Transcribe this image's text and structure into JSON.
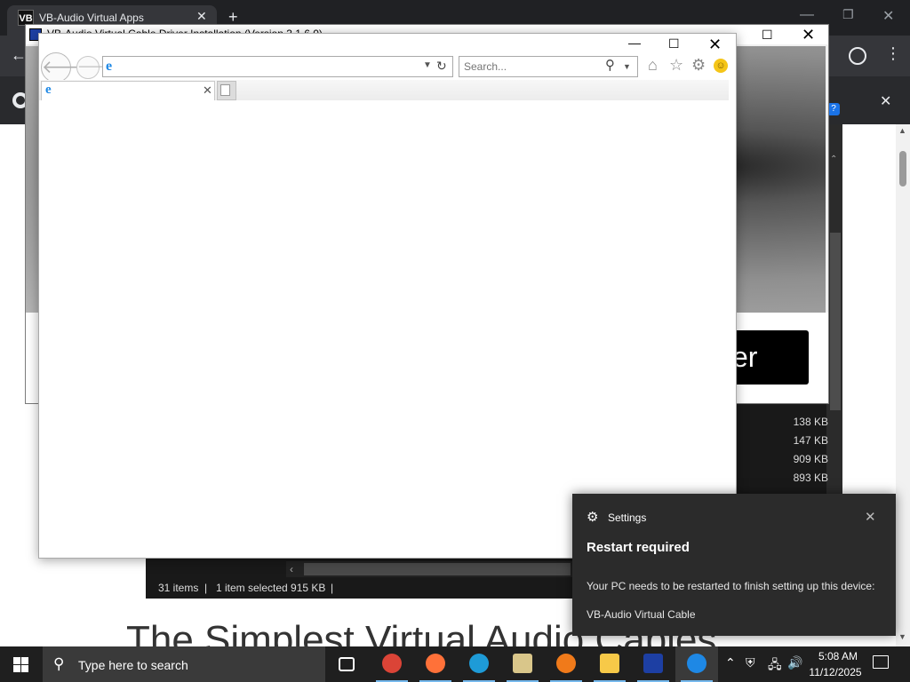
{
  "chrome": {
    "tab_title": "VB-Audio Virtual Apps",
    "favicon_text": "VB",
    "tab_close": "✕",
    "new_tab": "+",
    "minimize": "—",
    "maximize": "❐",
    "close": "✕",
    "back": "←",
    "menu": "⋮",
    "infobar_close": "✕",
    "infobar_help": "?",
    "page_heading": "The Simplest Virtual Audio Cables"
  },
  "explorer": {
    "file_sizes": [
      "138 KB",
      "147 KB",
      "909 KB",
      "893 KB"
    ],
    "status_items": "31 items",
    "status_selected": "1 item selected  915 KB"
  },
  "installer": {
    "title": "VB-Audio Virtual Cable Driver Installation (Version 3.1.6.0)",
    "maximize": "☐",
    "close": "✕",
    "button_label": "er"
  },
  "ie": {
    "minimize": "—",
    "maximize": "☐",
    "close": "✕",
    "back": "🡐",
    "forward": "🡒",
    "address_value": "",
    "search_placeholder": "Search...",
    "tab_title": "",
    "tab_close": "✕",
    "refresh": "↻",
    "dropdown": "▼",
    "search_icon": "⚲",
    "home": "⌂",
    "star": "☆",
    "gear": "⚙",
    "smiley": "☺",
    "ie_glyph": "e"
  },
  "toast": {
    "app_name": "Settings",
    "close": "✕",
    "gear": "⚙",
    "title": "Restart required",
    "body": "Your PC needs to be restarted to finish setting up this device:",
    "device": "VB-Audio Virtual Cable"
  },
  "taskbar": {
    "search_placeholder": "Type here to search",
    "search_icon": "⚲",
    "time": "5:08 AM",
    "date": "11/12/2025",
    "tray_chevron": "⌃",
    "tray_shield": "⛨",
    "tray_network": "🖧",
    "tray_volume": "🔊",
    "apps": [
      {
        "name": "task-view",
        "color": "#ffffff"
      },
      {
        "name": "chrome",
        "color": "#db4437"
      },
      {
        "name": "firefox",
        "color": "#ff7139"
      },
      {
        "name": "edge",
        "color": "#1e9bd7"
      },
      {
        "name": "setup-app",
        "color": "#d9c68a"
      },
      {
        "name": "fl-studio",
        "color": "#f07a1a"
      },
      {
        "name": "file-explorer",
        "color": "#f7c948"
      },
      {
        "name": "vb-audio-installer",
        "color": "#1d3fa3"
      },
      {
        "name": "internet-explorer",
        "color": "#1e88e5"
      }
    ]
  },
  "colors": {
    "chrome_dark": "#202124",
    "explorer_dark": "#191919",
    "toast_bg": "#2b2b2b",
    "taskbar_bg": "#1f1f1f",
    "accent": "#76b9ed"
  }
}
